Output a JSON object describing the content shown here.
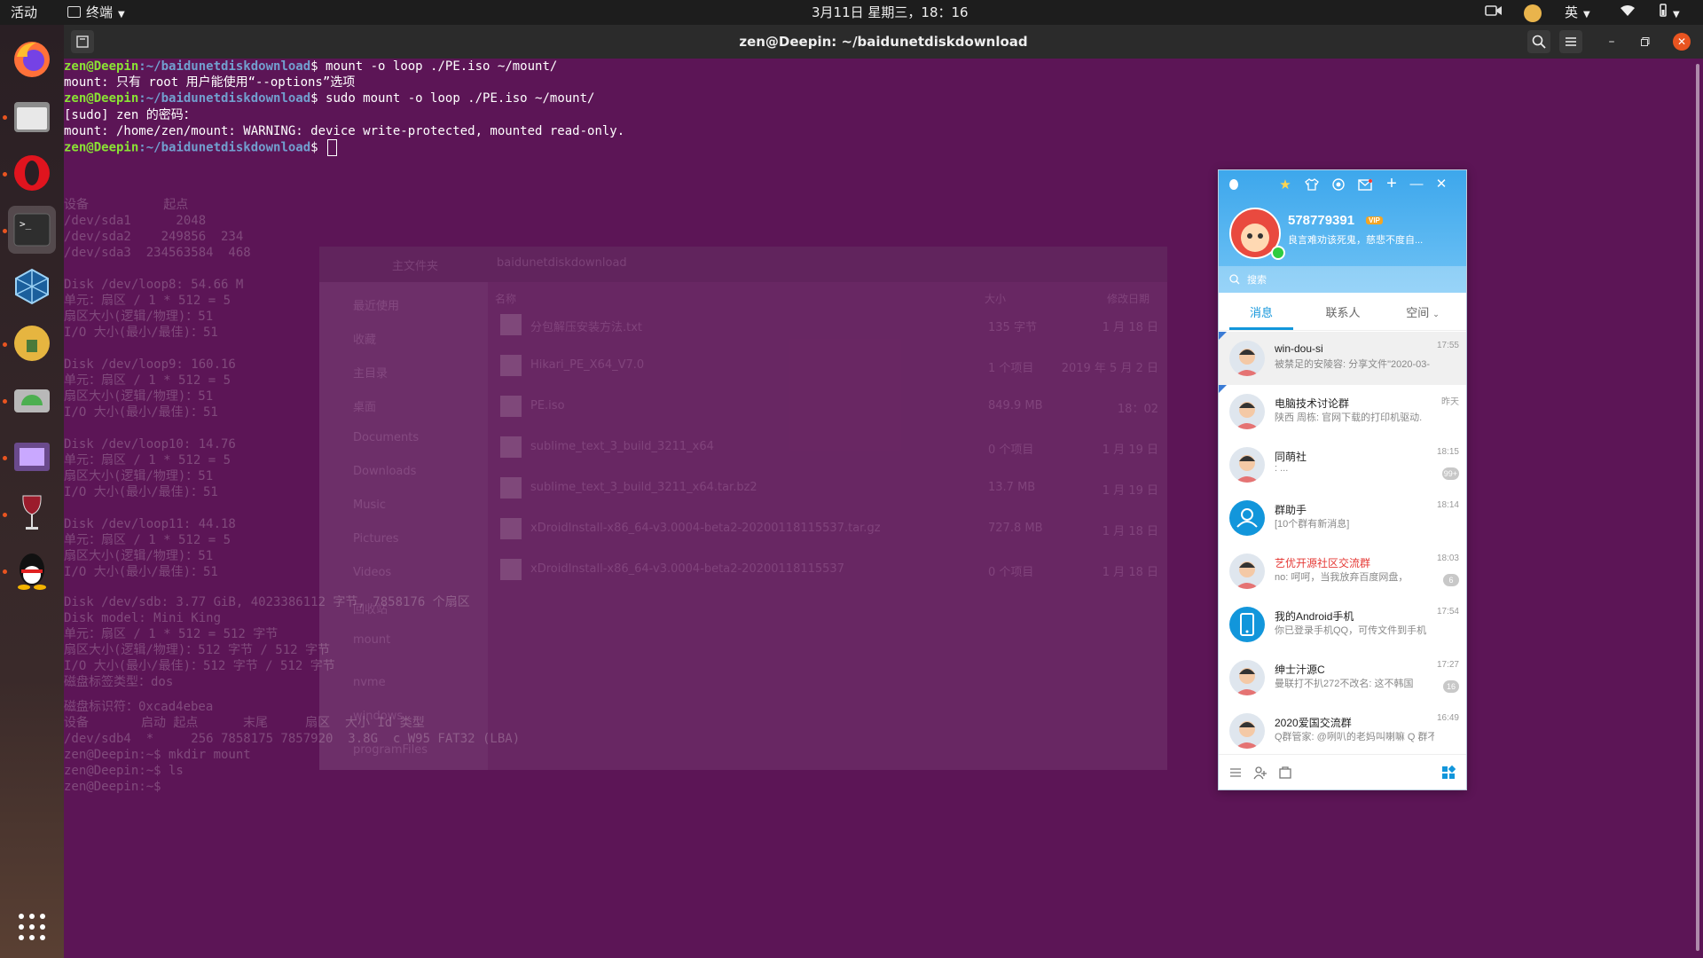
{
  "topbar": {
    "activities": "活动",
    "terminal_menu": "终端",
    "clock": "3月11日 星期三，18：16",
    "input_method": "英"
  },
  "window": {
    "title": "zen@Deepin: ~/baidunetdiskdownload"
  },
  "terminal": {
    "user_host": "zen@Deepin",
    "path": ":~/baidunetdiskdownload",
    "lines": [
      {
        "prompt": true,
        "cmd": "$ mount -o loop ./PE.iso ~/mount/"
      },
      {
        "prompt": false,
        "text": "mount: 只有 root 用户能使用“--options”选项"
      },
      {
        "prompt": true,
        "cmd": "$ sudo mount -o loop ./PE.iso ~/mount/"
      },
      {
        "prompt": false,
        "text": "[sudo] zen 的密码："
      },
      {
        "prompt": false,
        "text": "mount: /home/zen/mount: WARNING: device write-protected, mounted read-only."
      },
      {
        "prompt": true,
        "cmd": "$ "
      }
    ],
    "background_lines": [
      "设备          起点",
      "/dev/sda1      2048",
      "/dev/sda2    249856  234",
      "/dev/sda3  234563584  468",
      "Disk /dev/loop8: 54.66 M",
      "单元：扇区 / 1 * 512 = 5",
      "扇区大小(逻辑/物理)：51",
      "I/O 大小(最小/最佳)：51",
      "Disk /dev/loop9: 160.16",
      "单元：扇区 / 1 * 512 = 5",
      "扇区大小(逻辑/物理)：51",
      "I/O 大小(最小/最佳)：51",
      "Disk /dev/loop10: 14.76",
      "单元：扇区 / 1 * 512 = 5",
      "扇区大小(逻辑/物理)：51",
      "I/O 大小(最小/最佳)：51",
      "Disk /dev/loop11: 44.18",
      "单元：扇区 / 1 * 512 = 5",
      "扇区大小(逻辑/物理)：51",
      "I/O 大小(最小/最佳)：51",
      "Disk /dev/sdb: 3.77 GiB, 4023386112 字节, 7858176 个扇区",
      "Disk model: Mini King",
      "单元：扇区 / 1 * 512 = 512 字节",
      "扇区大小(逻辑/物理)：512 字节 / 512 字节",
      "I/O 大小(最小/最佳)：512 字节 / 512 字节",
      "磁盘标签类型：dos",
      "磁盘标识符：0xcad4ebea",
      "设备       启动 起点      末尾     扇区  大小 Id 类型",
      "/dev/sdb4  *     256 7858175 7857920  3.8G  c W95 FAT32 (LBA)",
      "zen@Deepin:~$ mkdir mount",
      "zen@Deepin:~$ ls",
      "zen@Deepin:~$"
    ]
  },
  "file_manager": {
    "location": "主文件夹",
    "folder": "baidunetdiskdownload",
    "columns": [
      "名称",
      "大小",
      "修改日期"
    ],
    "sidebar": [
      "最近使用",
      "收藏",
      "主目录",
      "桌面",
      "Documents",
      "Downloads",
      "Music",
      "Pictures",
      "Videos",
      "回收站",
      "mount",
      "nvme",
      "windows",
      "programFiles"
    ],
    "files": [
      {
        "name": "分包解压安装方法.txt",
        "size": "135 字节",
        "date": "1 月 18 日"
      },
      {
        "name": "Hikari_PE_X64_V7.0",
        "size": "1 个项目",
        "date": "2019 年 5 月 2 日"
      },
      {
        "name": "PE.iso",
        "size": "849.9 MB",
        "date": "18：02"
      },
      {
        "name": "sublime_text_3_build_3211_x64",
        "size": "0 个项目",
        "date": "1 月 19 日"
      },
      {
        "name": "sublime_text_3_build_3211_x64.tar.bz2",
        "size": "13.7 MB",
        "date": "1 月 19 日"
      },
      {
        "name": "xDroidInstall-x86_64-v3.0004-beta2-20200118115537.tar.gz",
        "size": "727.8 MB",
        "date": "1 月 18 日"
      },
      {
        "name": "xDroidInstall-x86_64-v3.0004-beta2-20200118115537",
        "size": "0 个项目",
        "date": "1 月 18 日"
      }
    ]
  },
  "qq": {
    "account": "578779391",
    "vip_label": "VIP",
    "signature": "良言难劝该死鬼，慈悲不度自...",
    "search_placeholder": "搜索",
    "tabs": [
      "消息",
      "联系人",
      "空间"
    ],
    "chats": [
      {
        "name": "win-dou-si",
        "preview": "被禁足的安陵容: 分享文件\"2020-03-",
        "time": "17:55",
        "badge": ""
      },
      {
        "name": "电脑技术讨论群",
        "preview": "陕西 周栋: 官网下载的打印机驱动.",
        "time": "昨天",
        "badge": ""
      },
      {
        "name": "同萌社",
        "preview": ": ...",
        "time": "18:15",
        "badge": "99+"
      },
      {
        "name": "群助手",
        "preview": "[10个群有新消息]",
        "time": "18:14",
        "badge": ""
      },
      {
        "name": "艺优开源社区交流群",
        "preview": "no: 呵呵，当我放弃百度网盘，",
        "time": "18:03",
        "badge": "6"
      },
      {
        "name": "我的Android手机",
        "preview": "你已登录手机QQ，可传文件到手机",
        "time": "17:54",
        "badge": ""
      },
      {
        "name": "绅士汁源C",
        "preview": "曼联打不扒272不改名: 这不韩国",
        "time": "17:27",
        "badge": "16"
      },
      {
        "name": "2020爱国交流群",
        "preview": "Q群管家: @咧叭的老妈叫喇嘛 Q 群不",
        "time": "16:49",
        "badge": ""
      }
    ],
    "colors": {
      "header": "#3da7ec",
      "red_name": "#e53935",
      "accent": "#1296db"
    }
  }
}
